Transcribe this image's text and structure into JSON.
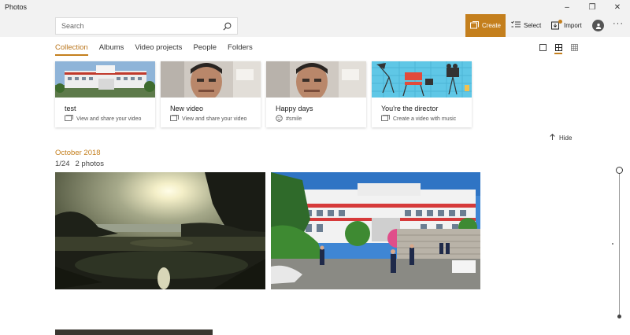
{
  "window": {
    "title": "Photos",
    "controls": {
      "minimize": "–",
      "maximize": "❐",
      "close": "✕"
    }
  },
  "search": {
    "placeholder": "Search",
    "value": ""
  },
  "toolbar": {
    "create_label": "Create",
    "select_label": "Select",
    "import_label": "Import",
    "more_label": "···"
  },
  "tabs": [
    {
      "label": "Collection",
      "active": true
    },
    {
      "label": "Albums",
      "active": false
    },
    {
      "label": "Video projects",
      "active": false
    },
    {
      "label": "People",
      "active": false
    },
    {
      "label": "Folders",
      "active": false
    }
  ],
  "view_toggles": [
    "single-view-icon",
    "grid-medium-icon",
    "grid-small-icon"
  ],
  "cards": [
    {
      "title": "test",
      "subtitle": "View and share your video",
      "icon": "video-project-icon"
    },
    {
      "title": "New video",
      "subtitle": "View and share your video",
      "icon": "video-project-icon"
    },
    {
      "title": "Happy days",
      "subtitle": "#smile",
      "icon": "smile-icon"
    },
    {
      "title": "You're the director",
      "subtitle": "Create a video with music",
      "icon": "video-project-icon"
    }
  ],
  "hide_label": "Hide",
  "section": {
    "month": "October 2018",
    "date": "1/24",
    "count": "2 photos"
  },
  "colors": {
    "accent": "#c47f1d",
    "header_bg": "#f2f2f2"
  }
}
